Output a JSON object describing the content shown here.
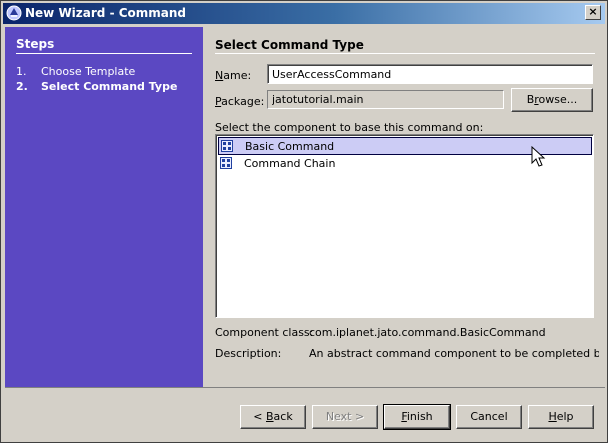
{
  "window": {
    "title": "New Wizard - Command",
    "close_glyph": "×"
  },
  "steps": {
    "title": "Steps",
    "items": [
      {
        "num": "1.",
        "label": "Choose Template"
      },
      {
        "num": "2.",
        "label": "Select Command Type"
      }
    ]
  },
  "main": {
    "section_title": "Select Command Type",
    "name": {
      "label_u": "N",
      "label_rest": "ame:",
      "value": "UserAccessCommand"
    },
    "package": {
      "label_u": "P",
      "label_rest": "ackage:",
      "value": "jatotutorial.main"
    },
    "browse": {
      "label_pre": "B",
      "label_u": "r",
      "label_rest": "owse..."
    },
    "list_caption": "Select the component to base this command on:",
    "components": [
      {
        "label": "Basic Command",
        "icon": "component-icon",
        "selected": true
      },
      {
        "label": "Command Chain",
        "icon": "component-icon",
        "selected": false
      }
    ],
    "component_class": {
      "label": "Component class:",
      "value": "com.iplanet.jato.command.BasicCommand"
    },
    "description": {
      "label": "Description:",
      "value": "An abstract command component to be completed by the..."
    }
  },
  "footer": {
    "back": {
      "pre": "< ",
      "u": "B",
      "rest": "ack"
    },
    "next": {
      "label": "Next >"
    },
    "finish": {
      "u": "F",
      "rest": "inish"
    },
    "cancel": {
      "label": "Cancel"
    },
    "help": {
      "u": "H",
      "rest": "elp"
    }
  },
  "colors": {
    "steps_bg": "#5b48c2",
    "selection_bg": "#ccccf5",
    "title_gradient_start": "#0a246a"
  }
}
